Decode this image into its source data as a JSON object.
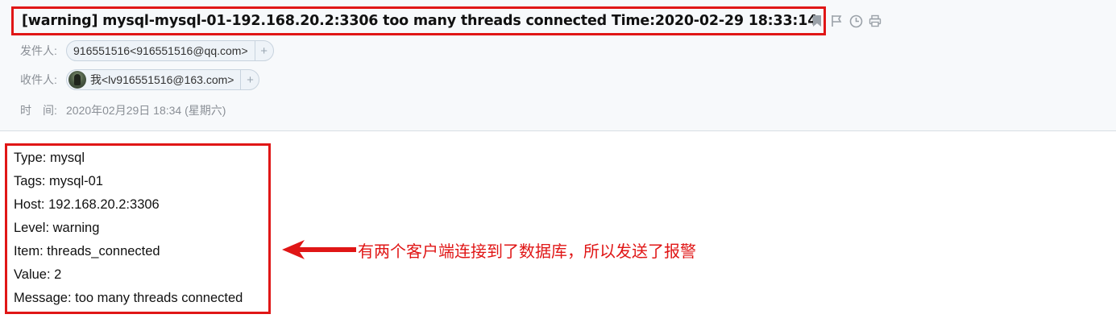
{
  "subject": "[warning] mysql-mysql-01-192.168.20.2:3306 too many threads connected Time:2020-02-29 18:33:14",
  "toolbar": {
    "icons": [
      "bookmark-icon",
      "flag-icon",
      "clock-icon",
      "print-icon"
    ]
  },
  "sender": {
    "label": "发件人:",
    "name": "916551516",
    "email": "<916551516@qq.com>",
    "add": "+"
  },
  "recipient": {
    "label": "收件人:",
    "name": "我",
    "email": "<lv916551516@163.com>",
    "add": "+"
  },
  "time": {
    "label": "时　间:",
    "value": "2020年02月29日 18:34 (星期六)"
  },
  "body": {
    "lines": [
      "Type: mysql",
      "Tags: mysql-01",
      "Host: 192.168.20.2:3306",
      "Level: warning",
      "Item: threads_connected",
      "Value: 2",
      "Message: too many threads connected"
    ]
  },
  "annotation": {
    "text": "有两个客户端连接到了数据库，所以发送了报警"
  },
  "colors": {
    "highlight": "#e01616",
    "header_bg": "#f7f9fb",
    "chip_bg": "#eef3f8"
  }
}
